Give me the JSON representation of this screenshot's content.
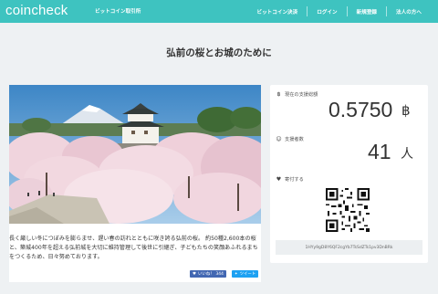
{
  "nav": {
    "logo": "coincheck",
    "tagline": "ビットコイン取引所",
    "links": [
      "ビットコイン決済",
      "ログイン",
      "新規登録",
      "法人の方へ"
    ]
  },
  "page": {
    "title": "弘前の桜とお城のために"
  },
  "project": {
    "description": "長く厳しい冬につぼみを膨らませ、遅い春の訪れとともに咲き誇る弘前の桜。 約50種2,600本の桜と、築城400年を超える弘前城を大切に維持管理して後世に引継ぎ、子どもたちの笑顔あふれるまちをつくるため、日々努めております。",
    "share": {
      "like_label": "いいね！",
      "like_count": "344",
      "tweet_label": "ツイート"
    }
  },
  "sidebar": {
    "amount_label": "現在の支援総額",
    "amount_value": "0.5750",
    "amount_unit": "฿",
    "supporters_label": "支援者数",
    "supporters_value": "41",
    "supporters_unit": "人",
    "donate_label": "寄付する",
    "address": "1HYy9gD8Y6QF2cgYb7TsSdZTs1pv3DnBRk"
  },
  "colors": {
    "brand": "#3ec3c0",
    "background": "#eef1f3",
    "facebook": "#4267b2",
    "twitter": "#1da1f2"
  },
  "icons": {
    "amount": "bitcoin-icon",
    "supporters": "people-icon",
    "donate": "heart-icon"
  }
}
